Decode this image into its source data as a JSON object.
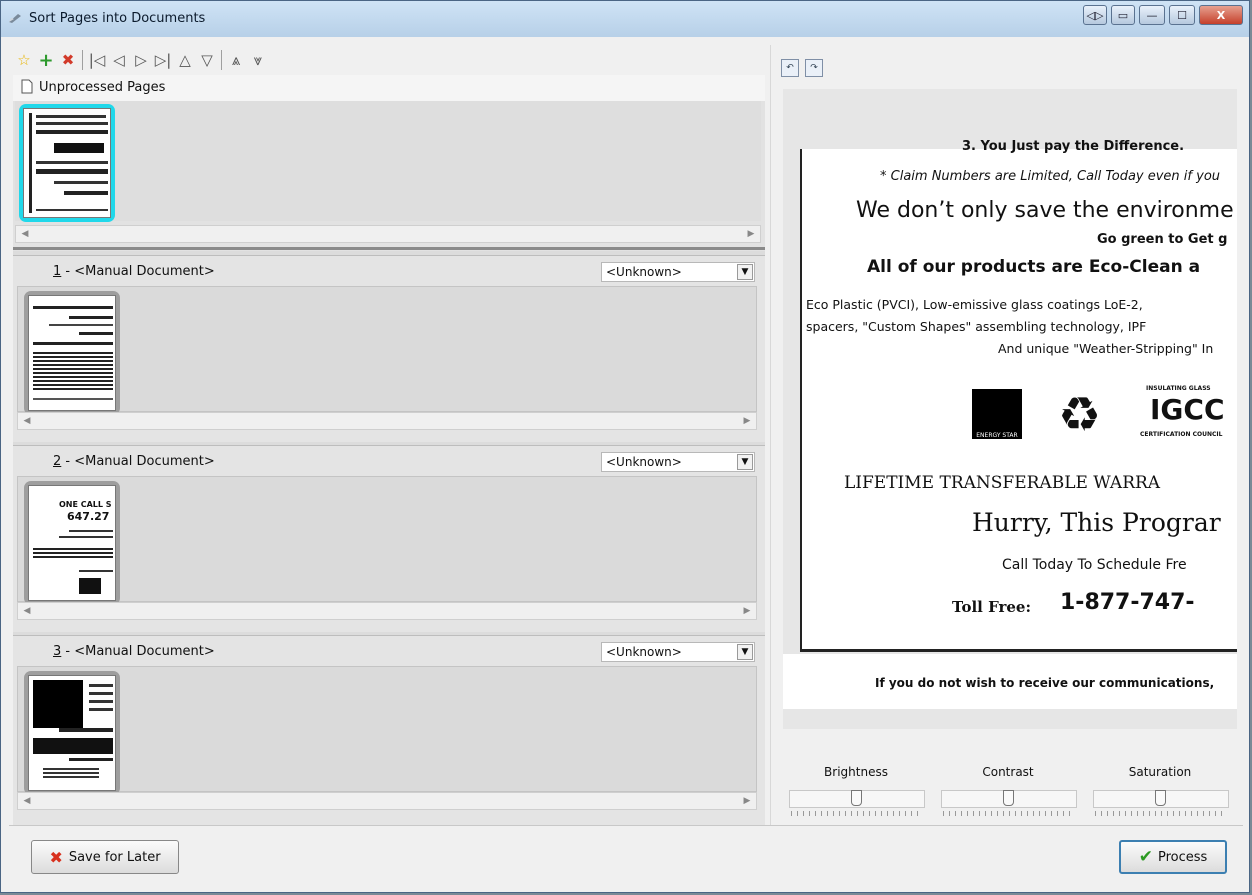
{
  "window": {
    "title": "Sort Pages into Documents",
    "title_buttons": [
      "◁▷",
      "▭",
      "—",
      "☐",
      "X"
    ]
  },
  "toolbar": {
    "icons": [
      "star-icon",
      "plus-icon",
      "delete-icon",
      "first-icon",
      "prev-icon",
      "next-icon",
      "last-icon",
      "move-up-icon",
      "move-down-icon",
      "move-top-icon",
      "move-bottom-icon"
    ]
  },
  "unprocessed": {
    "label": "Unprocessed Pages",
    "selected_color": "#1fd6e9"
  },
  "documents": [
    {
      "number": "1",
      "label": " - <Manual Document>",
      "type": "<Unknown>"
    },
    {
      "number": "2",
      "label": " - <Manual Document>",
      "type": "<Unknown>"
    },
    {
      "number": "3",
      "label": " - <Manual Document>",
      "type": "<Unknown>"
    }
  ],
  "thumbs": {
    "doc2_text": {
      "l1": "ONE CALL S",
      "l2": "647.27"
    }
  },
  "preview": {
    "lines": {
      "l1": "3. You Just pay the Difference.",
      "l2": "* Claim Numbers are Limited, Call Today even if you",
      "l3": "We don’t only save the environme",
      "l4": "Go green to Get g",
      "l5": "All of our products are Eco-Clean a",
      "l6": "Eco Plastic (PVCI), Low-emissive glass coatings LoE-2, ",
      "l7": "spacers, \"Custom Shapes\" assembling technology, IPF",
      "l8": "And unique \"Weather-Stripping\" In",
      "l9": "LIFETIME TRANSFERABLE WARRA",
      "l10": "Hurry, This Prograr",
      "l11": "Call Today To Schedule Fre",
      "l12a": "Toll Free:",
      "l12b": "1-877-747-",
      "l13": "If you do not wish to receive our communications,",
      "logo1": "ENERGY STAR",
      "logo2": "IGCC",
      "logo2_top": "INSULATING GLASS",
      "logo2_bot": "CERTIFICATION COUNCIL"
    }
  },
  "adjust": {
    "brightness": {
      "label": "Brightness",
      "value": 0.5
    },
    "contrast": {
      "label": "Contrast",
      "value": 0.5
    },
    "saturation": {
      "label": "Saturation",
      "value": 0.5
    }
  },
  "buttons": {
    "save_later": "Save for Later",
    "process": "Process"
  }
}
